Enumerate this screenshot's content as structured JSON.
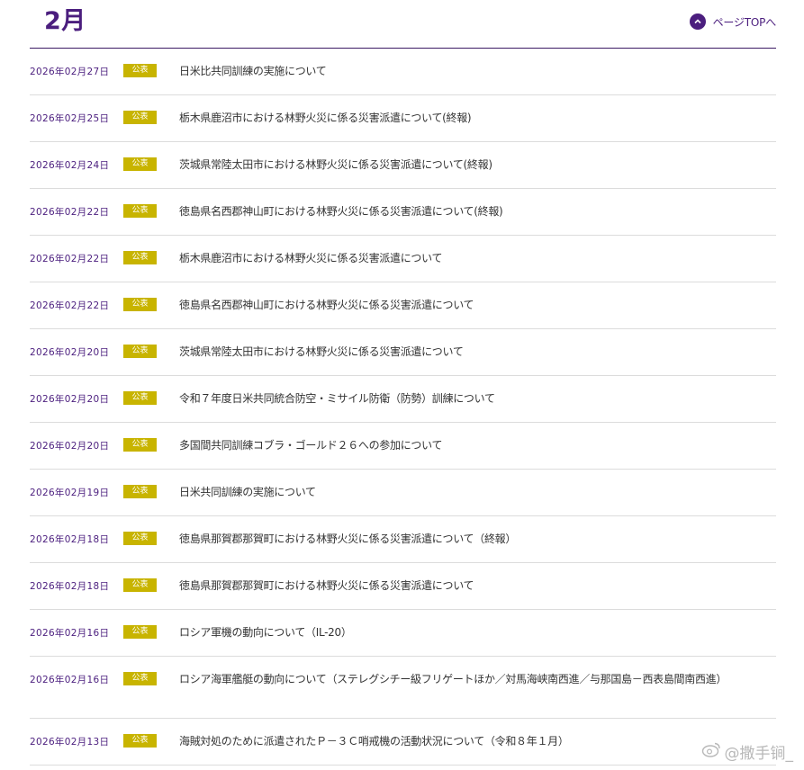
{
  "section": {
    "title": "2月",
    "page_top_label": "ページTOPへ"
  },
  "news_items": [
    {
      "date": "2026年02月27日",
      "badge": "公表",
      "title": "日米比共同訓練の実施について"
    },
    {
      "date": "2026年02月25日",
      "badge": "公表",
      "title": "栃木県鹿沼市における林野火災に係る災害派遣について(終報)"
    },
    {
      "date": "2026年02月24日",
      "badge": "公表",
      "title": "茨城県常陸太田市における林野火災に係る災害派遣について(終報)"
    },
    {
      "date": "2026年02月22日",
      "badge": "公表",
      "title": "徳島県名西郡神山町における林野火災に係る災害派遣について(終報)"
    },
    {
      "date": "2026年02月22日",
      "badge": "公表",
      "title": "栃木県鹿沼市における林野火災に係る災害派遣について"
    },
    {
      "date": "2026年02月22日",
      "badge": "公表",
      "title": "徳島県名西郡神山町における林野火災に係る災害派遣について"
    },
    {
      "date": "2026年02月20日",
      "badge": "公表",
      "title": "茨城県常陸太田市における林野火災に係る災害派遣について"
    },
    {
      "date": "2026年02月20日",
      "badge": "公表",
      "title": "令和７年度日米共同統合防空・ミサイル防衛（防勢）訓練について"
    },
    {
      "date": "2026年02月20日",
      "badge": "公表",
      "title": "多国間共同訓練コブラ・ゴールド２６への参加について"
    },
    {
      "date": "2026年02月19日",
      "badge": "公表",
      "title": "日米共同訓練の実施について"
    },
    {
      "date": "2026年02月18日",
      "badge": "公表",
      "title": "徳島県那賀郡那賀町における林野火災に係る災害派遣について（終報）"
    },
    {
      "date": "2026年02月18日",
      "badge": "公表",
      "title": "徳島県那賀郡那賀町における林野火災に係る災害派遣について"
    },
    {
      "date": "2026年02月16日",
      "badge": "公表",
      "title": "ロシア軍機の動向について（IL-20）"
    },
    {
      "date": "2026年02月16日",
      "badge": "公表",
      "title": "ロシア海軍艦艇の動向について（ステレグシチー級フリゲートほか／対馬海峡南西進／与那国島－西表島間南西進）"
    },
    {
      "date": "2026年02月13日",
      "badge": "公表",
      "title": "海賊対処のために派遣されたＰ－３Ｃ哨戒機の活動状況について（令和８年１月）"
    }
  ],
  "watermark": {
    "text": "@撒手锏_",
    "icon": "weibo-icon"
  },
  "colors": {
    "accent": "#4b1e7e",
    "badge": "#c8b400",
    "divider": "#dcdcdc",
    "text": "#333333"
  }
}
